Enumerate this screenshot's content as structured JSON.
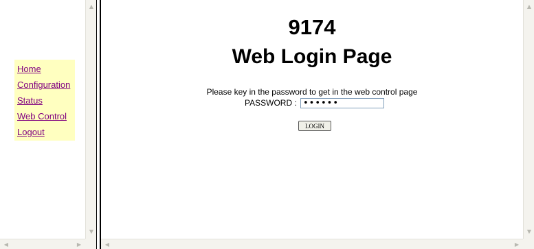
{
  "nav": {
    "items": [
      {
        "label": "Home"
      },
      {
        "label": "Configuration"
      },
      {
        "label": "Status"
      },
      {
        "label": "Web Control"
      },
      {
        "label": "Logout"
      }
    ]
  },
  "main": {
    "model": "9174",
    "title": "Web Login Page",
    "prompt": "Please key in the password to get in the web control page",
    "password_label": "PASSWORD :",
    "password_value": "******",
    "login_label": "LOGIN"
  },
  "colors": {
    "nav_background": "#ffffc0",
    "link_color": "#800080"
  },
  "icons": {
    "scroll_up": "scroll-up-arrow-icon",
    "scroll_down": "scroll-down-arrow-icon",
    "scroll_left": "scroll-left-arrow-icon",
    "scroll_right": "scroll-right-arrow-icon"
  }
}
